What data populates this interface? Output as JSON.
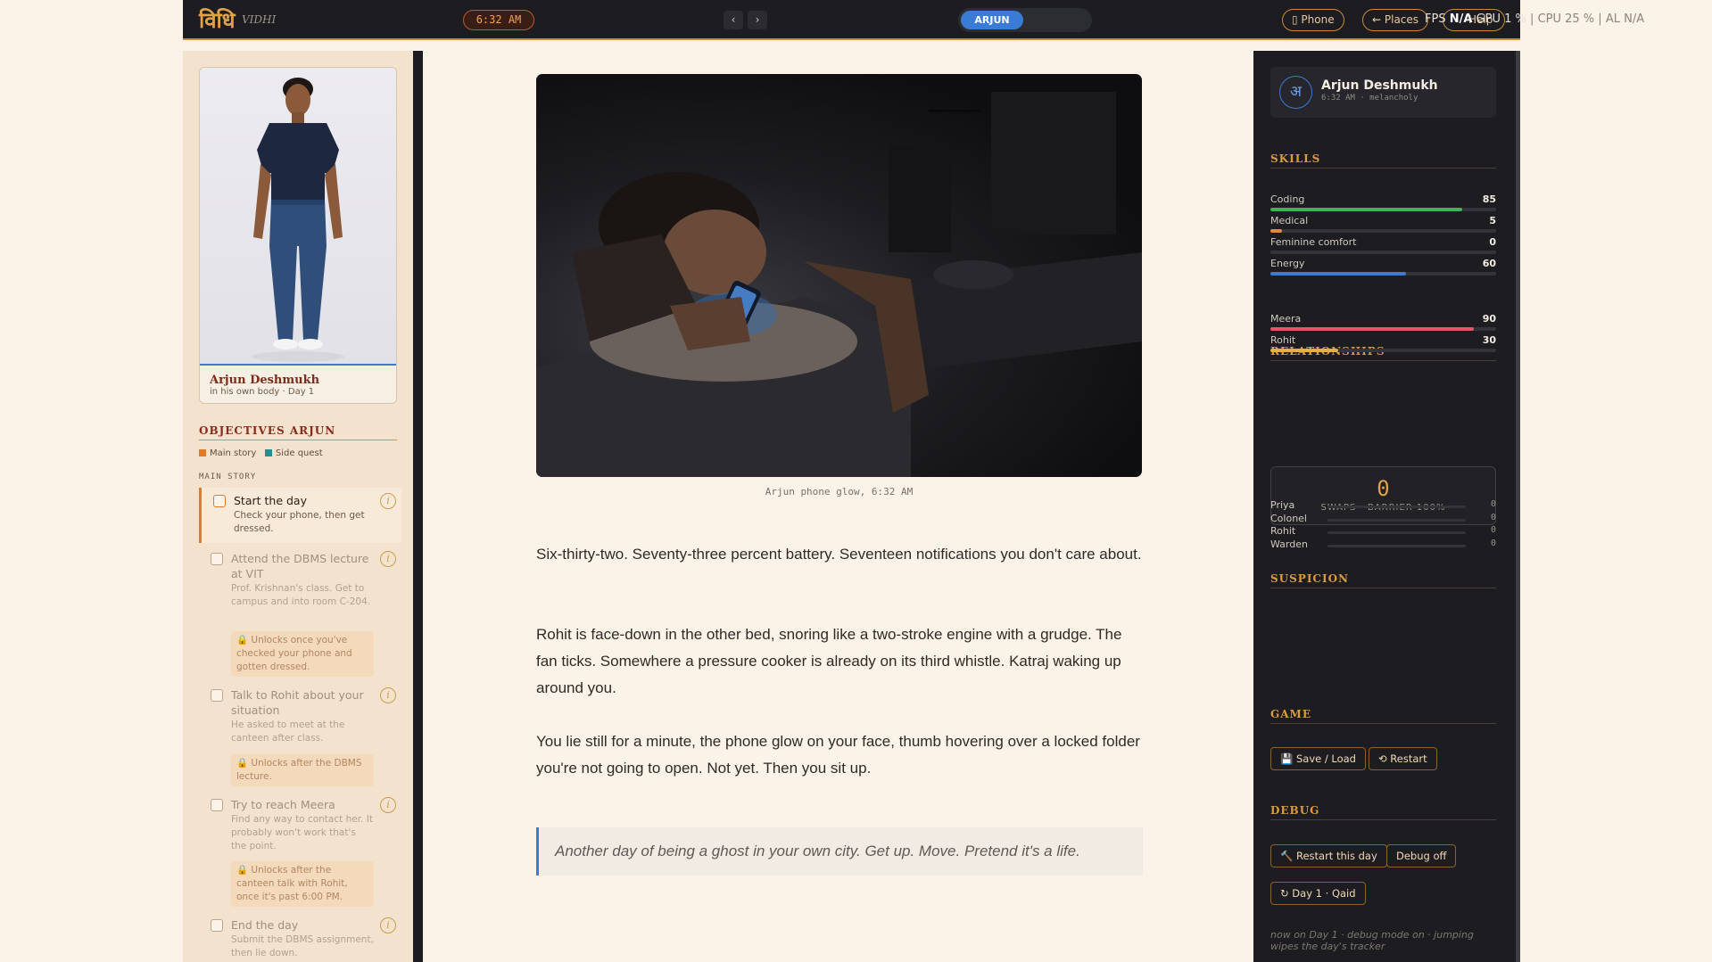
{
  "header": {
    "logo": "विधि",
    "logo_sub": "VIDHI",
    "clock": "6:32 AM",
    "nav_prev": "‹",
    "nav_next": "›",
    "body_toggle": "ARJUN",
    "buttons": {
      "phone": "Phone",
      "places": "Places",
      "help": "Help"
    },
    "perf": {
      "fps_label": "FPS",
      "fps_value": "N/A",
      "gpu": "GPU 1 %",
      "cpu": "CPU 25 %",
      "sep": "|",
      "misc": "AL N/A"
    }
  },
  "character": {
    "name": "Arjun Deshmukh",
    "subtitle": "in his own body · Day 1"
  },
  "objectives": {
    "title": "OBJECTIVES ARJUN",
    "legend_main": "Main story",
    "legend_side": "Side quest",
    "section": "MAIN STORY",
    "items": [
      {
        "title": "Start the day",
        "desc": "Check your phone, then get dressed.",
        "lock": ""
      },
      {
        "title": "Attend the DBMS lecture at VIT",
        "desc": "Prof. Krishnan's class. Get to campus and into room C-204.",
        "lock": "🔒 Unlocks once you've checked your phone and gotten dressed."
      },
      {
        "title": "Talk to Rohit about your situation",
        "desc": "He asked to meet at the canteen after class.",
        "lock": "🔒 Unlocks after the DBMS lecture."
      },
      {
        "title": "Try to reach Meera",
        "desc": "Find any way to contact her. It probably won't work that's the point.",
        "lock": "🔒 Unlocks after the canteen talk with Rohit, once it's past 6:00 PM."
      },
      {
        "title": "End the day",
        "desc": "Submit the DBMS assignment, then lie down.",
        "lock": ""
      }
    ],
    "info_glyph": "i"
  },
  "scene": {
    "caption": "Arjun phone glow, 6:32 AM",
    "paragraphs": [
      "Six-thirty-two. Seventy-three percent battery. Seventeen notifications you don't care about.",
      "Rohit is face-down in the other bed, snoring like a two-stroke engine with a grudge. The fan ticks. Somewhere a pressure cooker is already on its third whistle. Katraj waking up around you.",
      "You lie still for a minute, the phone glow on your face, thumb hovering over a locked folder you're not going to open. Not yet. Then you sit up."
    ],
    "quote": "Another day of being a ghost in your own city. Get up. Move. Pretend it's a life."
  },
  "sidebar": {
    "profile": {
      "avatar": "अ",
      "name": "Arjun Deshmukh",
      "sub": "6:32 AM · melancholy"
    },
    "skills_title": "SKILLS",
    "skills": [
      {
        "label": "Coding",
        "value": 85,
        "color": "#3cb55a"
      },
      {
        "label": "Medical",
        "value": 5,
        "color": "#e8893a"
      },
      {
        "label": "Feminine comfort",
        "value": 0,
        "color": "#e06a8a"
      },
      {
        "label": "Energy",
        "value": 60,
        "color": "#3a7bd5"
      }
    ],
    "relationships_title": "RELATIONSHIPS",
    "relationships": [
      {
        "label": "Meera",
        "value": 90,
        "color": "#e2566a"
      },
      {
        "label": "Rohit",
        "value": 30,
        "color": "#e0b04a"
      }
    ],
    "swaps": {
      "count": "0",
      "label": "SWAPS · BARRIER 100%"
    },
    "suspicion_title": "SUSPICION",
    "suspicion": [
      {
        "label": "Priya",
        "value": 0
      },
      {
        "label": "Colonel",
        "value": 0
      },
      {
        "label": "Rohit",
        "value": 0
      },
      {
        "label": "Warden",
        "value": 0
      }
    ],
    "game_title": "GAME",
    "game_buttons": {
      "save": "💾 Save / Load",
      "restart": "⟲ Restart"
    },
    "debug_title": "DEBUG",
    "debug_buttons": {
      "restart_day": "🔨 Restart this day",
      "debug_toggle": "Debug off",
      "day": "↻ Day 1 · Qaid"
    },
    "debug_note": "now on Day 1 · debug mode on · jumping wipes the day's tracker"
  },
  "colors": {
    "accent": "#d99a44",
    "brand_blue": "#3a7bd5",
    "main_story": "#e07b2c",
    "side_quest": "#2a8c8c"
  }
}
